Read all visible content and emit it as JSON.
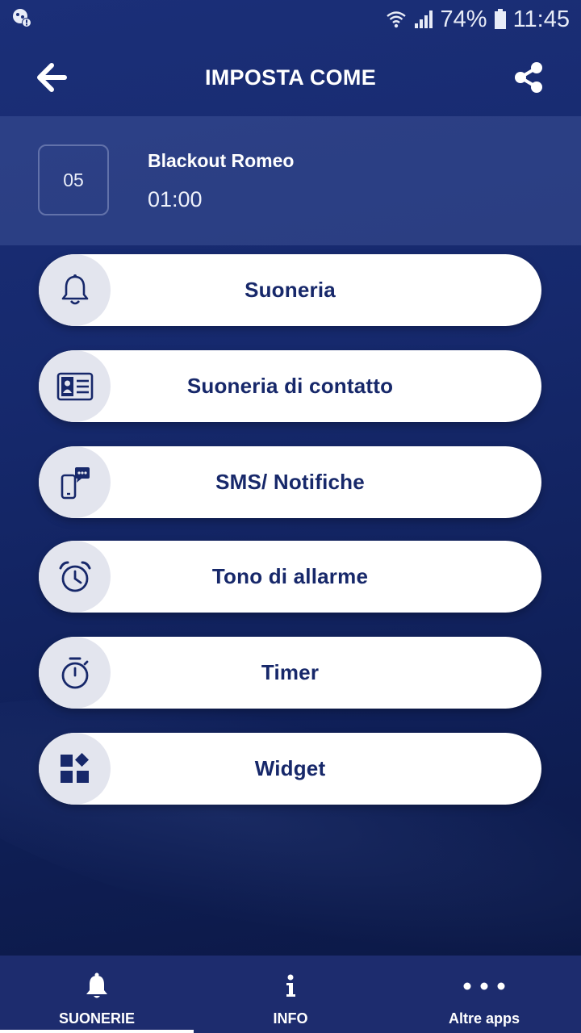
{
  "status_bar": {
    "battery": "74%",
    "time": "11:45"
  },
  "header": {
    "title": "IMPOSTA COME",
    "back_icon": "arrow-left-icon",
    "share_icon": "share-icon"
  },
  "track": {
    "number": "05",
    "name": "Blackout Romeo",
    "duration": "01:00"
  },
  "options": [
    {
      "label": "Suoneria",
      "icon": "bell-icon"
    },
    {
      "label": "Suoneria di contatto",
      "icon": "contact-card-icon"
    },
    {
      "label": "SMS/ Notifiche",
      "icon": "sms-phone-icon"
    },
    {
      "label": "Tono di allarme",
      "icon": "alarm-clock-icon"
    },
    {
      "label": "Timer",
      "icon": "stopwatch-icon"
    },
    {
      "label": "Widget",
      "icon": "widget-grid-icon"
    }
  ],
  "bottom_nav": [
    {
      "label": "SUONERIE",
      "icon": "bell-icon",
      "active": true
    },
    {
      "label": "INFO",
      "icon": "info-icon",
      "active": false
    },
    {
      "label": "Altre apps",
      "icon": "more-dots-icon",
      "active": false
    }
  ],
  "colors": {
    "background": "#16296d",
    "button_text": "#17286a",
    "nav_bar": "#1d2c6e"
  }
}
